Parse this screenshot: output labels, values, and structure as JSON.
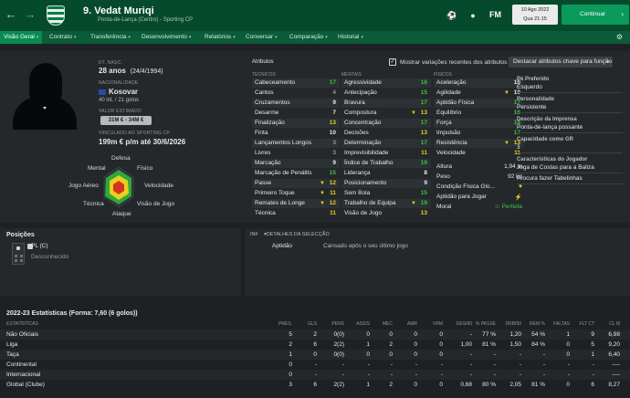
{
  "header": {
    "player_title": "9. Vedat Muriqi",
    "player_sub": "Ponta-de-Lança (Centro) - Sporting CP",
    "logo": "FM",
    "date_line1": "10 Ago 2022",
    "date_line2": "Qua 21:15",
    "continue_label": "Continuar"
  },
  "menu": [
    {
      "label": "Visão Geral",
      "active": true
    },
    {
      "label": "Contrato"
    },
    {
      "label": "Transferência"
    },
    {
      "label": "Desenvolvimento"
    },
    {
      "label": "Relatórios"
    },
    {
      "label": "Conversar"
    },
    {
      "label": "Comparação"
    },
    {
      "label": "Historial"
    }
  ],
  "profile": {
    "dob_label": "DT. NASC.",
    "age": "28 anos",
    "dob": "(24/4/1994)",
    "nationality_label": "NACIONALIDADE",
    "nation": "Kosovar",
    "caps": "40 int. / 21 golos",
    "value_label": "VALOR ESTIMADO",
    "value": "31M € - 34M €",
    "contract_label": "VINCULADO AO SPORTING CP",
    "contract": "199m € p/m até 30/6/2026"
  },
  "radar": {
    "top": "Defesa",
    "tl": "Mental",
    "tr": "Físico",
    "l": "Jogo Aéreo",
    "r": "Velocidade",
    "bl": "Técnica",
    "br": "Visão de Jogo",
    "bottom": "Ataque"
  },
  "attributes": {
    "title": "Atributos",
    "show_changes": "Mostrar variações recentes dos atributos",
    "highlight_dropdown": "Destacar atributos chave para função",
    "tech_head": "TÉCNICOS",
    "mental_head": "MENTAIS",
    "phys_head": "FÍSICOS",
    "technical": [
      {
        "name": "Cabeceamento",
        "value": "17",
        "color": "#3cc43c"
      },
      {
        "name": "Cantos",
        "value": "4",
        "color": "#8e979c"
      },
      {
        "name": "Cruzamentos",
        "value": "9",
        "color": "#e6e9eb"
      },
      {
        "name": "Desarme",
        "value": "7",
        "color": "#e6e9eb"
      },
      {
        "name": "Finalização",
        "value": "13",
        "color": "#e8d020"
      },
      {
        "name": "Finta",
        "value": "10",
        "color": "#e6e9eb"
      },
      {
        "name": "Lançamentos Longos",
        "value": "3",
        "color": "#8e979c"
      },
      {
        "name": "Livres",
        "value": "3",
        "color": "#8e979c"
      },
      {
        "name": "Marcação",
        "value": "9",
        "color": "#e6e9eb"
      },
      {
        "name": "Marcação de Penáltis",
        "value": "15",
        "color": "#3cc43c"
      },
      {
        "name": "Passe",
        "value": "12",
        "color": "#e8d020",
        "arrow": true
      },
      {
        "name": "Primeiro Toque",
        "value": "11",
        "color": "#e8d020",
        "arrow": true
      },
      {
        "name": "Remates de Longe",
        "value": "12",
        "color": "#e8d020",
        "arrow": true
      },
      {
        "name": "Técnica",
        "value": "11",
        "color": "#e8d020"
      }
    ],
    "mental": [
      {
        "name": "Agressividade",
        "value": "16",
        "color": "#3cc43c"
      },
      {
        "name": "Antecipação",
        "value": "15",
        "color": "#3cc43c"
      },
      {
        "name": "Bravura",
        "value": "17",
        "color": "#3cc43c"
      },
      {
        "name": "Compostura",
        "value": "13",
        "color": "#e8d020",
        "arrow": true
      },
      {
        "name": "Concentração",
        "value": "17",
        "color": "#3cc43c"
      },
      {
        "name": "Decisões",
        "value": "13",
        "color": "#e8d020"
      },
      {
        "name": "Determinação",
        "value": "17",
        "color": "#3cc43c"
      },
      {
        "name": "Imprevisibilidade",
        "value": "11",
        "color": "#e8d020"
      },
      {
        "name": "Índice de Trabalho",
        "value": "19",
        "color": "#3cc43c"
      },
      {
        "name": "Liderança",
        "value": "8",
        "color": "#e6e9eb"
      },
      {
        "name": "Posicionamento",
        "value": "9",
        "color": "#e6e9eb"
      },
      {
        "name": "Sem Bola",
        "value": "15",
        "color": "#3cc43c"
      },
      {
        "name": "Trabalho de Equipa",
        "value": "19",
        "color": "#3cc43c",
        "arrow": true
      },
      {
        "name": "Visão de Jogo",
        "value": "13",
        "color": "#e8d020"
      }
    ],
    "physical": [
      {
        "name": "Aceleração",
        "value": "10",
        "color": "#e6e9eb"
      },
      {
        "name": "Agilidade",
        "value": "10",
        "color": "#e6e9eb",
        "arrow": true
      },
      {
        "name": "Aptidão Física",
        "value": "17",
        "color": "#3cc43c"
      },
      {
        "name": "Equilíbrio",
        "value": "16",
        "color": "#3cc43c"
      },
      {
        "name": "Força",
        "value": "18",
        "color": "#3cc43c"
      },
      {
        "name": "Impulsão",
        "value": "17",
        "color": "#3cc43c"
      },
      {
        "name": "Resistência",
        "value": "13",
        "color": "#e8d020",
        "arrow": true
      },
      {
        "name": "Velocidade",
        "value": "11",
        "color": "#e8d020"
      }
    ],
    "height_label": "Altura",
    "height": "1,94 m",
    "weight_label": "Peso",
    "weight": "92 kg",
    "condition_label": "Condição Física Glo...",
    "fitness_label": "Aptidão para Jogar",
    "morale_label": "Moral",
    "morale": "Perfeita"
  },
  "highlights": [
    {
      "label": "Pé Preferido",
      "value": "Esquerdo"
    },
    {
      "label": "Personalidade",
      "value": "Persistente"
    },
    {
      "label": "Descrição da Imprensa",
      "value": "Ponta-de-lança possante"
    },
    {
      "label": "Capacidade como GR",
      "value": "3"
    },
    {
      "label": "Características do Jogador",
      "value": "Joga de Costas para a Baliza",
      "value2": "Procura fazer Tabelinhas"
    }
  ],
  "positions": {
    "title": "Posições",
    "main": "PL (C)",
    "other": "Desconhecido"
  },
  "details": {
    "tab_inf": "INF",
    "tab_details": "DETALHES DA SELECÇÃO",
    "row_label": "Aptidão",
    "row_value": "Cansado após o seu último jogo"
  },
  "stats": {
    "title": "2022-23 Estatísticas (Forma: 7,60 (6 golos))",
    "headers": [
      "ESTATÍSTICAS",
      "PRES.",
      "GLS",
      "PENS",
      "ASSIS",
      "MEC",
      "AMR",
      "VRM",
      "DES/90",
      "% PASSE",
      "DRB/90",
      "REM %",
      "FALTAS",
      "FLT CT",
      "CL M"
    ],
    "rows": [
      [
        "Não Oficiais",
        "5",
        "2",
        "0(0)",
        "0",
        "0",
        "0",
        "0",
        "-",
        "77 %",
        "1,20",
        "54 %",
        "1",
        "9",
        "6,98"
      ],
      [
        "Liga",
        "2",
        "6",
        "2(2)",
        "1",
        "2",
        "0",
        "0",
        "1,00",
        "81 %",
        "1,50",
        "84 %",
        "0",
        "5",
        "9,20"
      ],
      [
        "Taça",
        "1",
        "0",
        "0(0)",
        "0",
        "0",
        "0",
        "0",
        "-",
        "-",
        "-",
        "-",
        "0",
        "1",
        "6,40"
      ],
      [
        "Continental",
        "0",
        "-",
        "-",
        "-",
        "-",
        "-",
        "-",
        "-",
        "-",
        "-",
        "-",
        "-",
        "-",
        "----"
      ],
      [
        "Internacional",
        "0",
        "-",
        "-",
        "-",
        "-",
        "-",
        "-",
        "-",
        "-",
        "-",
        "-",
        "-",
        "-",
        "----"
      ],
      [
        "Global (Clube)",
        "3",
        "6",
        "2(2)",
        "1",
        "2",
        "0",
        "0",
        "0,68",
        "80 %",
        "2,05",
        "81 %",
        "0",
        "6",
        "8,27"
      ]
    ]
  }
}
